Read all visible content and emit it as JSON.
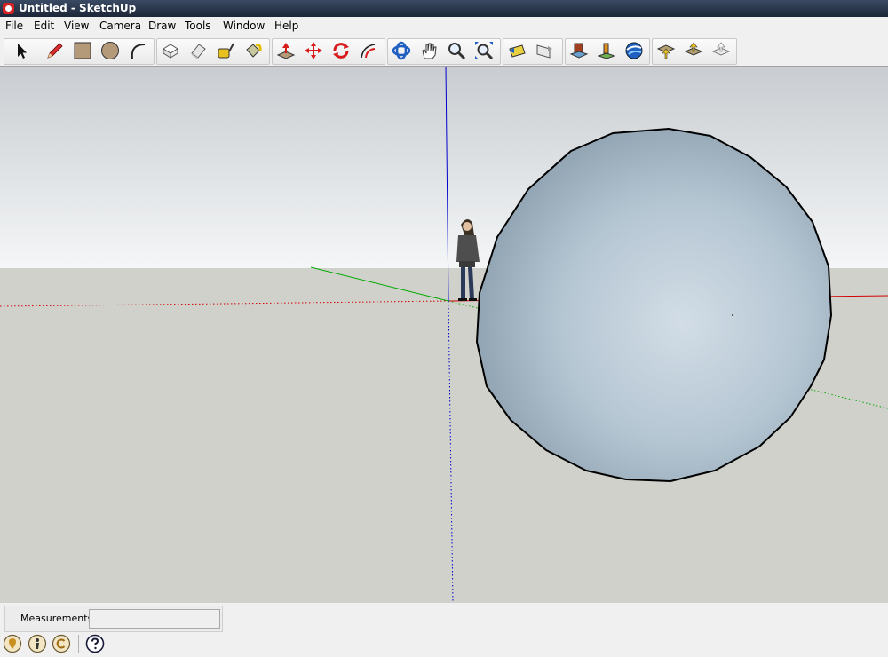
{
  "window": {
    "title": "Untitled - SketchUp"
  },
  "menu": {
    "items": [
      {
        "label": "File"
      },
      {
        "label": "Edit"
      },
      {
        "label": "View"
      },
      {
        "label": "Camera"
      },
      {
        "label": "Draw"
      },
      {
        "label": "Tools"
      },
      {
        "label": "Window"
      },
      {
        "label": "Help"
      }
    ]
  },
  "toolbar": {
    "tools": [
      "select-arrow-icon",
      "pencil-line-icon",
      "rectangle-icon",
      "circle-icon",
      "arc-icon",
      "make-component-icon",
      "eraser-icon",
      "tape-measure-icon",
      "paint-bucket-icon",
      "push-pull-icon",
      "move-icon",
      "rotate-icon",
      "offset-icon",
      "orbit-icon",
      "pan-hand-icon",
      "zoom-icon",
      "zoom-extents-icon",
      "previous-view-icon",
      "next-view-icon",
      "get-models-icon",
      "place-model-icon",
      "google-earth-icon",
      "get-current-view-icon",
      "toggle-terrain-icon",
      "share-model-icon"
    ]
  },
  "statusbar": {
    "measurements_label": "Measurements",
    "measurements_value": ""
  },
  "colors": {
    "sky_top": "#c9cdd1",
    "sky_bottom": "#f4f6f7",
    "ground": "#d1d1cc",
    "axis_red": "#d00000",
    "axis_green": "#00aa00",
    "axis_blue": "#0000cc",
    "sphere": "#bccbd6"
  }
}
